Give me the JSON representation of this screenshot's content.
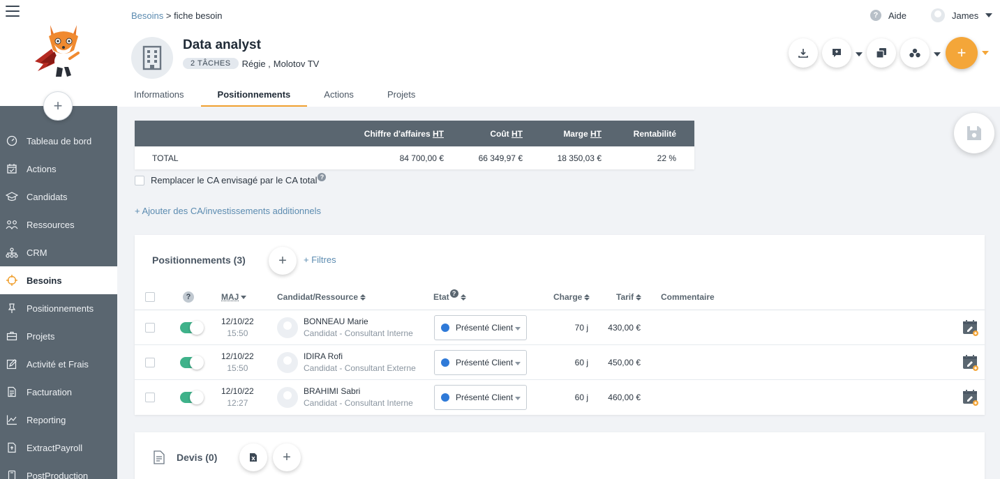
{
  "sidebar": {
    "items": [
      {
        "label": "Tableau de bord",
        "icon": "dashboard-icon"
      },
      {
        "label": "Actions",
        "icon": "calendar-icon"
      },
      {
        "label": "Candidats",
        "icon": "graduation-cap-icon"
      },
      {
        "label": "Ressources",
        "icon": "people-icon"
      },
      {
        "label": "CRM",
        "icon": "org-chart-icon"
      },
      {
        "label": "Besoins",
        "icon": "crosshair-icon",
        "active": true
      },
      {
        "label": "Positionnements",
        "icon": "pin-icon"
      },
      {
        "label": "Projets",
        "icon": "briefcase-icon"
      },
      {
        "label": "Activité et Frais",
        "icon": "edit-icon"
      },
      {
        "label": "Facturation",
        "icon": "invoice-icon"
      },
      {
        "label": "Reporting",
        "icon": "chart-line-icon"
      },
      {
        "label": "ExtractPayroll",
        "icon": "extract-icon"
      },
      {
        "label": "PostProduction",
        "icon": "device-icon"
      }
    ]
  },
  "header": {
    "breadcrumb_link": "Besoins",
    "breadcrumb_sep": ">",
    "breadcrumb_current": "fiche besoin",
    "help_label": "Aide",
    "user_name": "James",
    "title": "Data analyst",
    "badge": "2 TÂCHES",
    "subtitle_type": "Régie ,",
    "subtitle_company": "Molotov TV",
    "accent_color": "#f4a639"
  },
  "tabs": [
    "Informations",
    "Positionnements",
    "Actions",
    "Projets"
  ],
  "totals": {
    "headers": {
      "ca_prefix": "Chiffre d'affaires ",
      "cout_prefix": "Coût ",
      "marge_prefix": "Marge ",
      "ht": "HT",
      "rentabilite": "Rentabilité"
    },
    "row_label": "TOTAL",
    "ca": "84 700,00 €",
    "cout": "66 349,97 €",
    "marge": "18 350,03 €",
    "rentabilite": "22 %"
  },
  "replace_label": "Remplacer le CA envisagé par le CA total",
  "add_ca_label": "+ Ajouter des CA/investissements additionnels",
  "positionnements": {
    "title": "Positionnements (3)",
    "filters_label": "+ Filtres",
    "columns": {
      "help": "?",
      "maj": "MAJ",
      "candidat": "Candidat/Ressource",
      "etat": "Etat",
      "charge": "Charge",
      "tarif": "Tarif",
      "commentaire": "Commentaire"
    },
    "rows": [
      {
        "date": "12/10/22",
        "time": "15:50",
        "name": "BONNEAU Marie",
        "role": "Candidat - Consultant Interne",
        "etat": "Présenté Client",
        "charge": "70 j",
        "tarif": "430,00 €"
      },
      {
        "date": "12/10/22",
        "time": "15:50",
        "name": "IDIRA Rofi",
        "role": "Candidat - Consultant Externe",
        "etat": "Présenté Client",
        "charge": "60 j",
        "tarif": "450,00 €"
      },
      {
        "date": "12/10/22",
        "time": "12:27",
        "name": "BRAHIMI Sabri",
        "role": "Candidat - Consultant Interne",
        "etat": "Présenté Client",
        "charge": "60 j",
        "tarif": "460,00 €"
      }
    ]
  },
  "devis": {
    "title": "Devis (0)"
  }
}
